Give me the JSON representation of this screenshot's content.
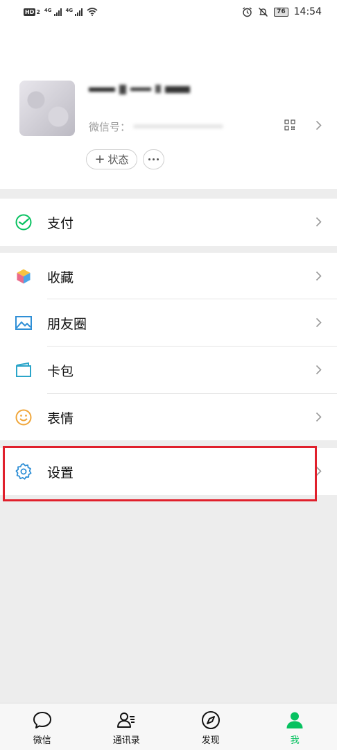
{
  "status_bar": {
    "hd_badge": "HD",
    "hd_sub": "2",
    "net1": "4G",
    "net2": "4G",
    "battery": "76",
    "time": "14:54"
  },
  "profile": {
    "wechat_id_label": "微信号：",
    "status_button": "状态",
    "status_button_plus": "+"
  },
  "menu": {
    "pay": "支付",
    "favorites": "收藏",
    "moments": "朋友圈",
    "cards": "卡包",
    "stickers": "表情",
    "settings": "设置"
  },
  "tabbar": {
    "chats": "微信",
    "contacts": "通讯录",
    "discover": "发现",
    "me": "我"
  },
  "colors": {
    "accent_green": "#07c160",
    "highlight_red": "#e0202c"
  },
  "icons": {
    "pay": "wechat-pay-icon",
    "favorites": "cube-icon",
    "moments": "picture-icon",
    "cards": "wallet-icon",
    "stickers": "smiley-icon",
    "settings": "gear-icon"
  }
}
